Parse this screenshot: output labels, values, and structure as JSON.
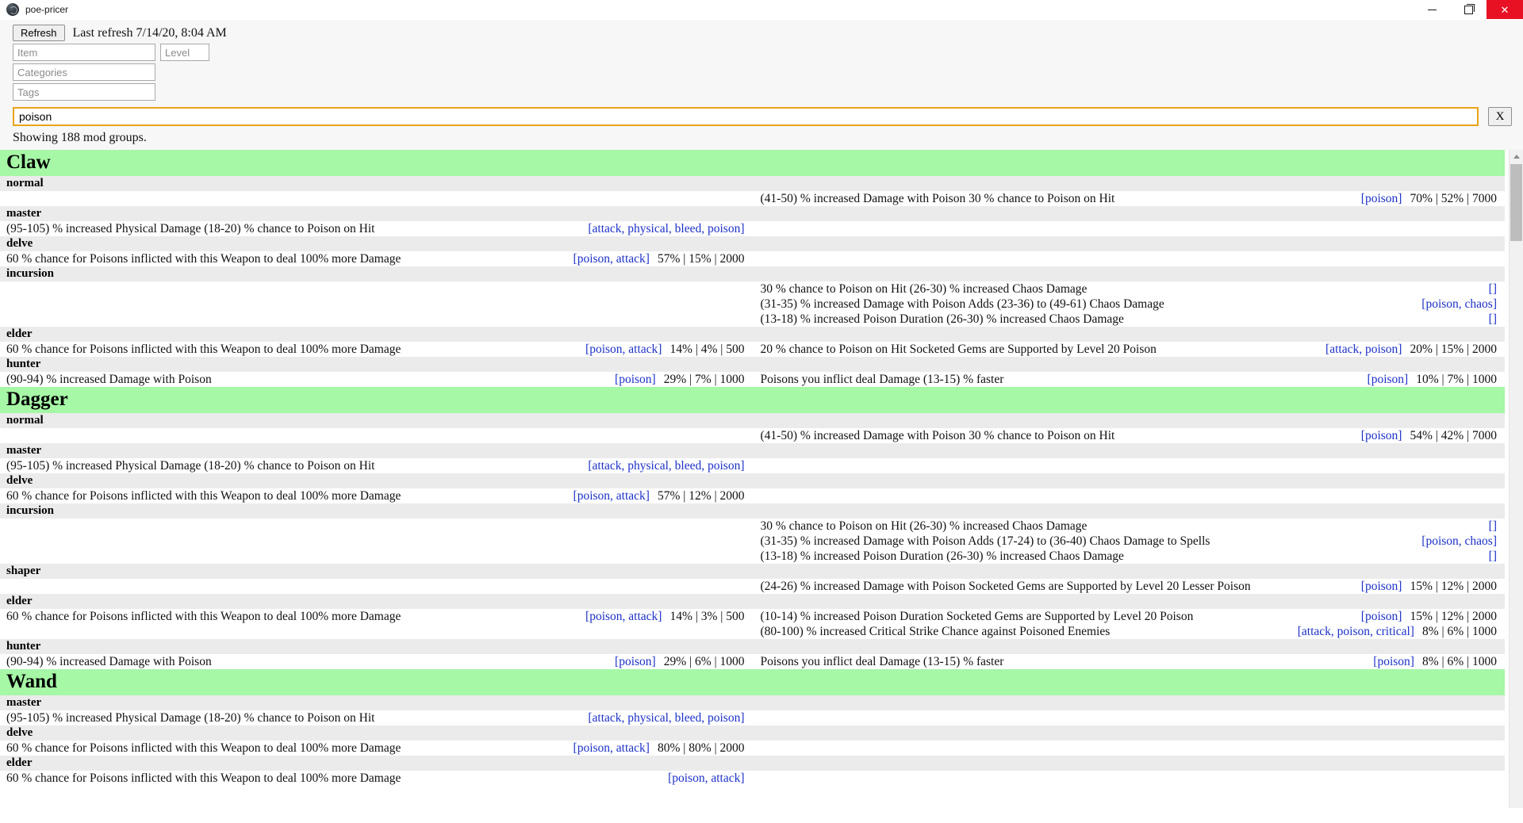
{
  "window": {
    "title": "poe-pricer",
    "icon": "app-icon",
    "controls": {
      "minimize": "—",
      "maximize": "❐",
      "close": "✕"
    }
  },
  "toolbar": {
    "refresh_label": "Refresh",
    "last_refresh": "Last refresh 7/14/20, 8:04 AM",
    "item_placeholder": "Item",
    "item_value": "",
    "level_placeholder": "Level",
    "level_value": "",
    "categories_placeholder": "Categories",
    "categories_value": "",
    "tags_placeholder": "Tags",
    "tags_value": "",
    "search_value": "poison",
    "search_placeholder": "",
    "clear_label": "X",
    "status": "Showing 188 mod groups.",
    "focus_color": "#e8a317"
  },
  "groups": [
    {
      "name": "Claw",
      "tiers": [
        {
          "label": "normal",
          "rows": [
            {
              "left": [],
              "right": [
                {
                  "text": "(41-50) % increased Damage with Poison 30 % chance to Poison on Hit",
                  "tags": "[poison]",
                  "stats": "70% | 52% | 7000"
                }
              ]
            }
          ]
        },
        {
          "label": "master",
          "rows": [
            {
              "left": [
                {
                  "text": "(95-105) % increased Physical Damage (18-20) % chance to Poison on Hit",
                  "tags": "[attack, physical, bleed, poison]",
                  "stats": ""
                }
              ],
              "right": []
            }
          ]
        },
        {
          "label": "delve",
          "rows": [
            {
              "left": [
                {
                  "text": "60 % chance for Poisons inflicted with this Weapon to deal 100% more Damage",
                  "tags": "[poison, attack]",
                  "stats": "57% | 15% | 2000"
                }
              ],
              "right": []
            }
          ]
        },
        {
          "label": "incursion",
          "rows": [
            {
              "left": [],
              "right": [
                {
                  "text": "30 % chance to Poison on Hit (26-30) % increased Chaos Damage",
                  "tags": "[]",
                  "stats": ""
                },
                {
                  "text": "(31-35) % increased Damage with Poison Adds (23-36) to (49-61) Chaos Damage",
                  "tags": "[poison, chaos]",
                  "stats": ""
                },
                {
                  "text": "(13-18) % increased Poison Duration (26-30) % increased Chaos Damage",
                  "tags": "[]",
                  "stats": ""
                }
              ]
            }
          ]
        },
        {
          "label": "elder",
          "rows": [
            {
              "left": [
                {
                  "text": "60 % chance for Poisons inflicted with this Weapon to deal 100% more Damage",
                  "tags": "[poison, attack]",
                  "stats": "14% | 4% | 500"
                }
              ],
              "right": [
                {
                  "text": "20 % chance to Poison on Hit Socketed Gems are Supported by Level 20 Poison",
                  "tags": "[attack, poison]",
                  "stats": "20% | 15% | 2000"
                }
              ]
            }
          ]
        },
        {
          "label": "hunter",
          "rows": [
            {
              "left": [
                {
                  "text": "(90-94) % increased Damage with Poison",
                  "tags": "[poison]",
                  "stats": "29% | 7% | 1000"
                }
              ],
              "right": [
                {
                  "text": "Poisons you inflict deal Damage (13-15) % faster",
                  "tags": "[poison]",
                  "stats": "10% | 7% | 1000"
                }
              ]
            }
          ]
        }
      ]
    },
    {
      "name": "Dagger",
      "tiers": [
        {
          "label": "normal",
          "rows": [
            {
              "left": [],
              "right": [
                {
                  "text": "(41-50) % increased Damage with Poison 30 % chance to Poison on Hit",
                  "tags": "[poison]",
                  "stats": "54% | 42% | 7000"
                }
              ]
            }
          ]
        },
        {
          "label": "master",
          "rows": [
            {
              "left": [
                {
                  "text": "(95-105) % increased Physical Damage (18-20) % chance to Poison on Hit",
                  "tags": "[attack, physical, bleed, poison]",
                  "stats": ""
                }
              ],
              "right": []
            }
          ]
        },
        {
          "label": "delve",
          "rows": [
            {
              "left": [
                {
                  "text": "60 % chance for Poisons inflicted with this Weapon to deal 100% more Damage",
                  "tags": "[poison, attack]",
                  "stats": "57% | 12% | 2000"
                }
              ],
              "right": []
            }
          ]
        },
        {
          "label": "incursion",
          "rows": [
            {
              "left": [],
              "right": [
                {
                  "text": "30 % chance to Poison on Hit (26-30) % increased Chaos Damage",
                  "tags": "[]",
                  "stats": ""
                },
                {
                  "text": "(31-35) % increased Damage with Poison Adds (17-24) to (36-40) Chaos Damage to Spells",
                  "tags": "[poison, chaos]",
                  "stats": ""
                },
                {
                  "text": "(13-18) % increased Poison Duration (26-30) % increased Chaos Damage",
                  "tags": "[]",
                  "stats": ""
                }
              ]
            }
          ]
        },
        {
          "label": "shaper",
          "rows": [
            {
              "left": [],
              "right": [
                {
                  "text": "(24-26) % increased Damage with Poison Socketed Gems are Supported by Level 20 Lesser Poison",
                  "tags": "[poison]",
                  "stats": "15% | 12% | 2000"
                }
              ]
            }
          ]
        },
        {
          "label": "elder",
          "rows": [
            {
              "left": [
                {
                  "text": "60 % chance for Poisons inflicted with this Weapon to deal 100% more Damage",
                  "tags": "[poison, attack]",
                  "stats": "14% | 3% | 500"
                }
              ],
              "right": [
                {
                  "text": "(10-14) % increased Poison Duration Socketed Gems are Supported by Level 20 Poison",
                  "tags": "[poison]",
                  "stats": "15% | 12% | 2000"
                },
                {
                  "text": "(80-100) % increased Critical Strike Chance against Poisoned Enemies",
                  "tags": "[attack, poison, critical]",
                  "stats": "8% | 6% | 1000"
                }
              ]
            }
          ]
        },
        {
          "label": "hunter",
          "rows": [
            {
              "left": [
                {
                  "text": "(90-94) % increased Damage with Poison",
                  "tags": "[poison]",
                  "stats": "29% | 6% | 1000"
                }
              ],
              "right": [
                {
                  "text": "Poisons you inflict deal Damage (13-15) % faster",
                  "tags": "[poison]",
                  "stats": "8% | 6% | 1000"
                }
              ]
            }
          ]
        }
      ]
    },
    {
      "name": "Wand",
      "tiers": [
        {
          "label": "master",
          "rows": [
            {
              "left": [
                {
                  "text": "(95-105) % increased Physical Damage (18-20) % chance to Poison on Hit",
                  "tags": "[attack, physical, bleed, poison]",
                  "stats": ""
                }
              ],
              "right": []
            }
          ]
        },
        {
          "label": "delve",
          "rows": [
            {
              "left": [
                {
                  "text": "60 % chance for Poisons inflicted with this Weapon to deal 100% more Damage",
                  "tags": "[poison, attack]",
                  "stats": "80% | 80% | 2000"
                }
              ],
              "right": []
            }
          ]
        },
        {
          "label": "elder",
          "rows": [
            {
              "left": [
                {
                  "text": "60 % chance for Poisons inflicted with this Weapon to deal 100% more Damage",
                  "tags": "[poison, attack]",
                  "stats": ""
                }
              ],
              "right": []
            }
          ]
        }
      ]
    }
  ],
  "scrollbar": {
    "up_arrow": "up-arrow",
    "down_arrow": "down-arrow"
  }
}
